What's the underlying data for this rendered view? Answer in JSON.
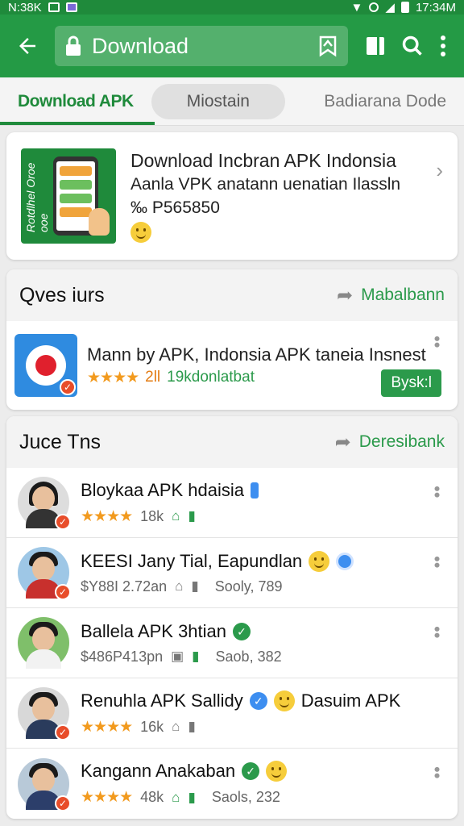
{
  "status_bar": {
    "left_text": "N:38K",
    "time": "17:34M"
  },
  "app_bar": {
    "url": "Download"
  },
  "tabs": [
    {
      "label": "Download APK"
    },
    {
      "label": "Miostain"
    },
    {
      "label": "Badiarana Dode"
    }
  ],
  "hero": {
    "line1": "Download Incbran APK Indonsia",
    "line2": "Aanla VPK anatann uenatian Ilassln",
    "line3": "‰ P565850",
    "thumb_side_text": "Rotdlhel Oroe ooe"
  },
  "section1": {
    "title": "Qves iurs",
    "link": "Mabalbann",
    "item": {
      "title": "Mann by APK, Indonsia APK taneia Insnest",
      "stars": "★★★★",
      "rating": "2ll",
      "downloads": "19kdonlatbat",
      "action": "Bysk:l"
    }
  },
  "section2": {
    "title": "Juce Tns",
    "link": "Deresibank",
    "items": [
      {
        "title": "Bloykaa APK hdaisia",
        "stars": "★★★★",
        "count": "18k",
        "extra": ""
      },
      {
        "title": "KEESI Jany Tial, Eapundlan",
        "stars": "",
        "count": "$Y88I 2.72an",
        "extra": "Sooly, 789"
      },
      {
        "title": "Ballela APK 3htian",
        "stars": "",
        "count": "$486P413pn",
        "extra": "Saob, 382"
      },
      {
        "title": "Renuhla APK Sallidy",
        "title_suffix": "Dasuim APK",
        "stars": "★★★★",
        "count": "16k",
        "extra": ""
      },
      {
        "title": "Kangann Anakaban",
        "stars": "★★★★",
        "count": "48k",
        "extra": "Saols, 232"
      }
    ]
  },
  "colors": {
    "primary": "#249a45",
    "accent_orange": "#f29a1e",
    "link_green": "#2b9a4b"
  },
  "icons": [
    "back-arrow-icon",
    "lock-icon",
    "bookmark-icon",
    "book-icon",
    "search-icon",
    "overflow-menu-icon",
    "chevron-right-icon",
    "share-icon",
    "kebab-icon"
  ]
}
